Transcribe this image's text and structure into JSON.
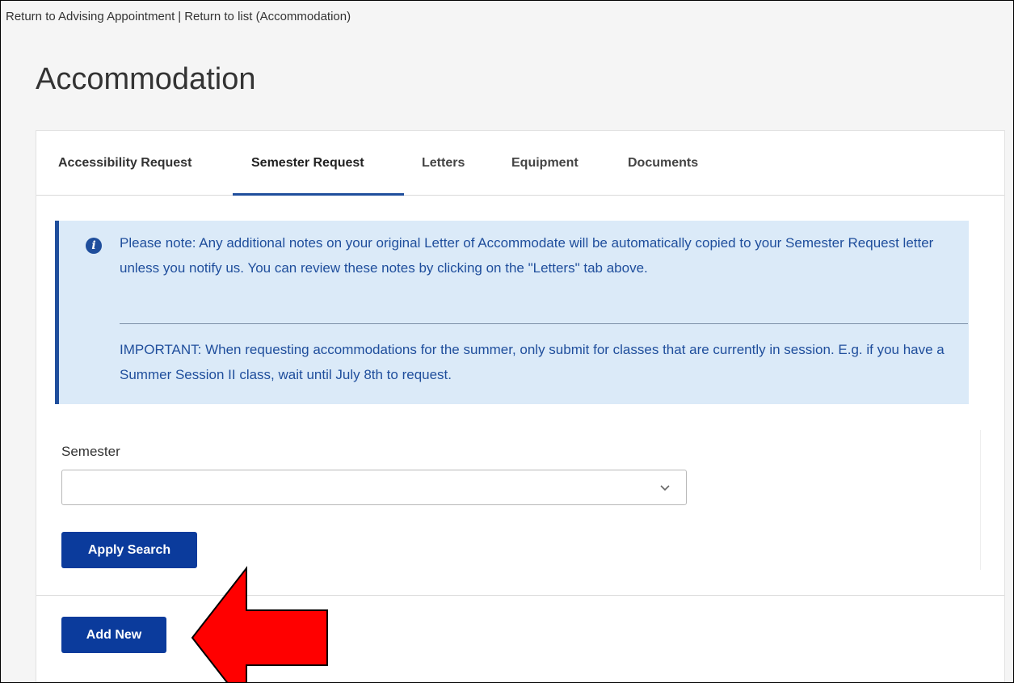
{
  "breadcrumb": {
    "return_advising": "Return to Advising Appointment",
    "separator": "|",
    "return_list": "Return to list (Accommodation)"
  },
  "page": {
    "title": "Accommodation"
  },
  "tabs": [
    {
      "label": "Accessibility Request",
      "active": false
    },
    {
      "label": "Semester Request",
      "active": true
    },
    {
      "label": "Letters",
      "active": false
    },
    {
      "label": "Equipment",
      "active": false
    },
    {
      "label": "Documents",
      "active": false
    }
  ],
  "notice": {
    "icon": "info-icon",
    "text1": "Please note: Any additional notes on your original Letter of Accommodate will be automatically copied to your Semester Request letter unless you notify us. You can review these notes by clicking on the \"Letters\" tab above.",
    "text2": "IMPORTANT: When requesting accommodations for the summer, only submit for classes that are currently in session. E.g. if you have a Summer Session II class, wait until July 8th to request."
  },
  "search": {
    "semester_label": "Semester",
    "semester_value": "",
    "apply_label": "Apply Search"
  },
  "actions": {
    "add_new_label": "Add New"
  },
  "colors": {
    "accent": "#1f4e9c",
    "button": "#0b3b9c",
    "notice_bg": "#dbeaf8",
    "annotation_arrow": "#ff0000"
  }
}
